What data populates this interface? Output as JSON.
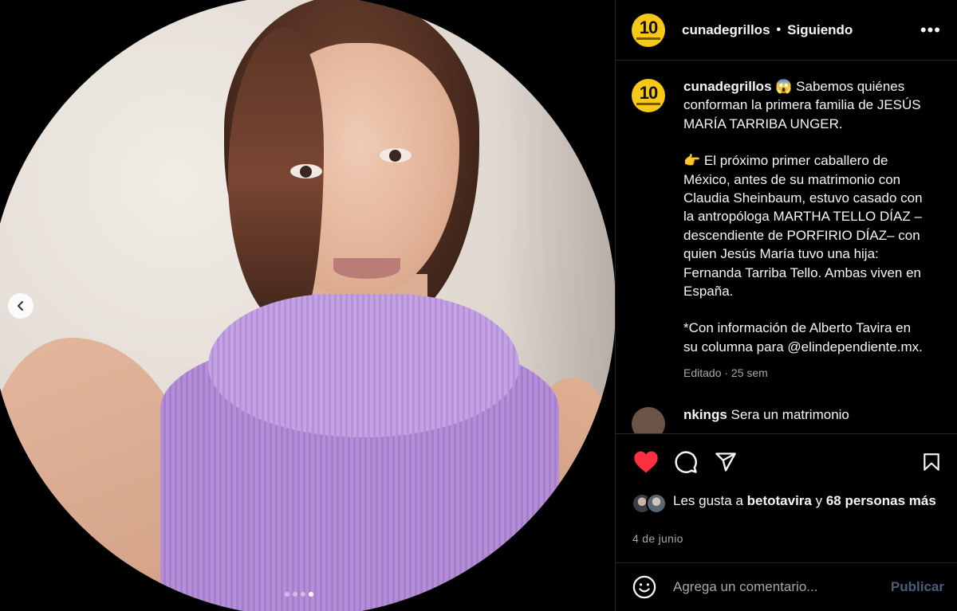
{
  "post": {
    "image_slide_count": 4,
    "image_active_slide": 4
  },
  "header": {
    "username": "cunadegrillos",
    "separator": "•",
    "follow_status": "Siguiendo",
    "more_label": "•••",
    "avatar_text": "10"
  },
  "caption": {
    "username": "cunadegrillos",
    "emoji": "😱",
    "lines": [
      "Sabemos quiénes conforman la primera familia de JESÚS MARÍA TARRIBA UNGER.",
      "",
      "👉 El próximo primer caballero de México, antes de su matrimonio con Claudia Sheinbaum, estuvo casado con la antropóloga MARTHA TELLO DÍAZ –descendiente de PORFIRIO DÍAZ– con quien Jesús María tuvo una hija: Fernanda Tarriba Tello. Ambas viven en España.",
      "",
      "*Con información de Alberto Tavira en su columna para @elindependiente.mx."
    ],
    "meta": "Editado · 25 sem"
  },
  "next_comment": {
    "username": "nkings",
    "text": "Sera un matrimonio"
  },
  "actions": {
    "like_icon": "heart-filled-icon",
    "comment_icon": "comment-icon",
    "share_icon": "share-icon",
    "save_icon": "bookmark-icon",
    "like_color": "#ff3040"
  },
  "likes": {
    "prefix": "Les gusta a ",
    "user": "betotavira",
    "middle": " y ",
    "others": "68 personas más"
  },
  "date": "4 de junio",
  "comment_box": {
    "placeholder": "Agrega un comentario...",
    "publish_label": "Publicar"
  },
  "colors": {
    "background": "#000000",
    "text": "#f5f5f5",
    "secondary_text": "#a8a8a8",
    "publish_disabled": "#4a5d7a",
    "avatar_yellow": "#f7c818",
    "sweater": "#b48fd7"
  }
}
